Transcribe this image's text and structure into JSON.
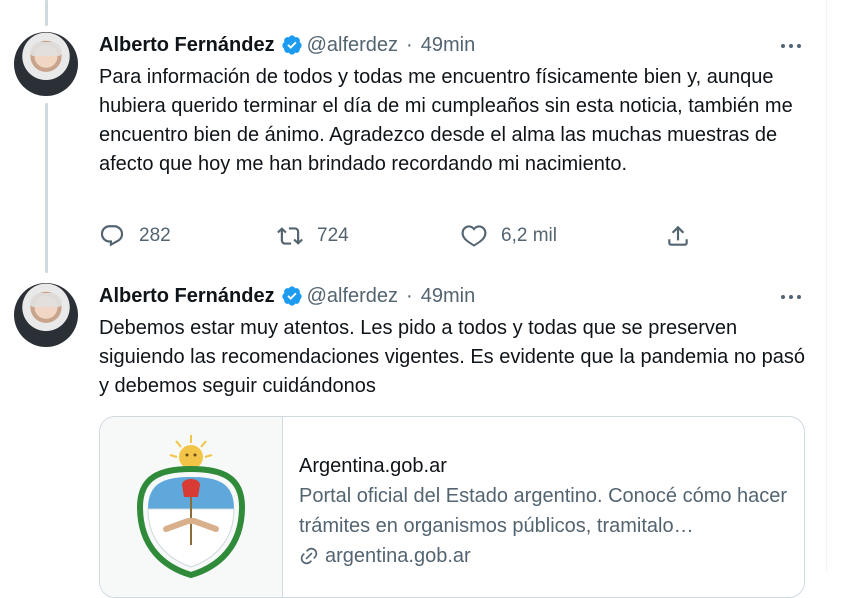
{
  "colors": {
    "text": "#0f1419",
    "muted": "#536471",
    "verified": "#1d9bf0",
    "border": "#cfd9de"
  },
  "tweets": [
    {
      "name": "Alberto Fernández",
      "handle": "@alferdez",
      "separator": "·",
      "time": "49min",
      "text": "Para información de todos y todas me encuentro físicamente bien y, aunque hubiera querido terminar el día de mi cumpleaños sin esta noticia, también me encuentro bien de ánimo. Agradezco desde el alma las muchas muestras de afecto que hoy me han brindado recordando mi nacimiento.",
      "replies": "282",
      "retweets": "724",
      "likes": "6,2 mil",
      "icons": [
        "reply-icon",
        "retweet-icon",
        "like-icon",
        "share-icon"
      ]
    },
    {
      "name": "Alberto Fernández",
      "handle": "@alferdez",
      "separator": "·",
      "time": "49min",
      "text": "Debemos estar muy atentos. Les pido a todos y todas que se preserven siguiendo las recomendaciones vigentes. Es evidente que la pandemia no pasó y debemos seguir cuidándonos",
      "card": {
        "domain": "Argentina.gob.ar",
        "description": "Portal oficial del Estado argentino. Conocé cómo hacer trámites en organismos públicos, tramitalo…",
        "link": "argentina.gob.ar"
      }
    }
  ]
}
